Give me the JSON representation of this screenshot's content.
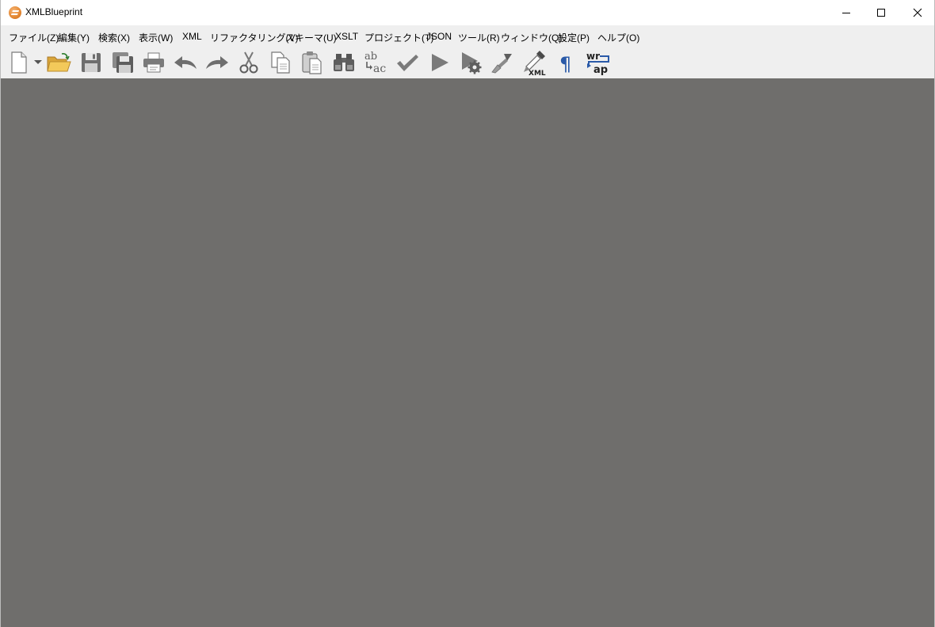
{
  "window": {
    "title": "XMLBlueprint"
  },
  "menu": {
    "items": [
      {
        "label": "ファイル(Z)"
      },
      {
        "label": "編集(Y)"
      },
      {
        "label": "検索(X)"
      },
      {
        "label": "表示(W)"
      },
      {
        "label": "XML"
      },
      {
        "label": "リファクタリング(V)"
      },
      {
        "label": "スキーマ(U)"
      },
      {
        "label": "XSLT"
      },
      {
        "label": "プロジェクト(T)"
      },
      {
        "label": "JSON"
      },
      {
        "label": "ツール(R)"
      },
      {
        "label": "ウィンドウ(Q)"
      },
      {
        "label": "設定(P)"
      },
      {
        "label": "ヘルプ(O)"
      }
    ]
  },
  "toolbar": {
    "buttons": [
      {
        "icon": "new-document-icon"
      },
      {
        "icon": "dropdown-arrow-icon"
      },
      {
        "icon": "open-folder-icon"
      },
      {
        "icon": "save-icon"
      },
      {
        "icon": "save-all-icon"
      },
      {
        "icon": "print-icon"
      },
      {
        "icon": "undo-icon"
      },
      {
        "icon": "redo-icon"
      },
      {
        "icon": "cut-icon"
      },
      {
        "icon": "copy-icon"
      },
      {
        "icon": "paste-icon"
      },
      {
        "icon": "find-binoculars-icon"
      },
      {
        "icon": "replace-icon"
      },
      {
        "icon": "validate-check-icon"
      },
      {
        "icon": "run-icon"
      },
      {
        "icon": "run-settings-icon"
      },
      {
        "icon": "clean-brush-icon"
      },
      {
        "icon": "xml-eyedropper-icon"
      },
      {
        "icon": "pilcrow-icon"
      },
      {
        "icon": "word-wrap-icon"
      }
    ],
    "replace_text_top": "ab",
    "replace_text_bottom": "ac",
    "xml_label": "XML",
    "pilcrow": "¶",
    "wrap_top": "wr",
    "wrap_bottom": "ap"
  },
  "colors": {
    "workspace": "#6f6e6c",
    "menubar": "#efefef",
    "icon_gray": "#6e6e6e",
    "folder_yellow": "#f0c048",
    "accent_blue": "#2a5aa8"
  }
}
